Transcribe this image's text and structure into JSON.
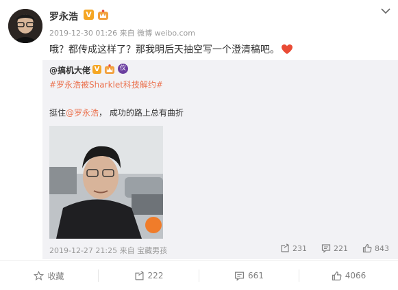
{
  "post": {
    "author": "罗永浩",
    "verified_badge": "V",
    "timestamp": "2019-12-30 01:26",
    "source_prefix": "来自",
    "source": "微博 weibo.com",
    "text": "哦？都传成这样了？那我明后天抽空写一个澄清稿吧。"
  },
  "repost": {
    "author": "@搞机大佬",
    "verified_badge": "V",
    "purple_badge": "仪",
    "hashtag": "#罗永浩被Sharklet科技解约#",
    "text_prefix": "挺住",
    "mention": "@罗永浩",
    "text_suffix": "， 成功的路上总有曲折",
    "timestamp": "2019-12-27 21:25",
    "source_prefix": "来自",
    "source": "宝藏男孩",
    "reposts": "231",
    "comments": "221",
    "likes": "843"
  },
  "actions": {
    "favorite_label": "收藏",
    "repost_count": "222",
    "comment_count": "661",
    "like_count": "4066"
  },
  "colors": {
    "accent_orange": "#eb7350",
    "badge_gold": "#f5a623",
    "heart_red": "#e94b35",
    "repost_bg": "#f2f2f5",
    "muted_text": "#999999"
  },
  "icons": [
    "chevron-down-icon",
    "heart-icon",
    "star-icon",
    "repost-icon",
    "comment-icon",
    "like-icon",
    "crown-badge-icon"
  ]
}
